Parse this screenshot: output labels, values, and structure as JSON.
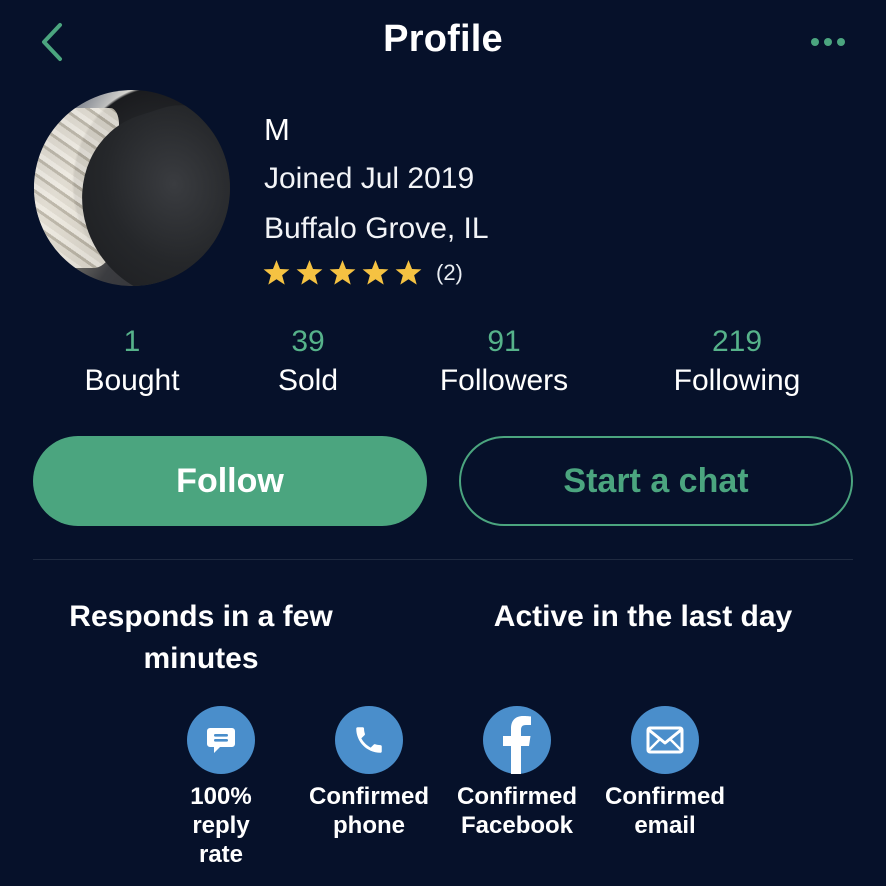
{
  "header": {
    "title": "Profile",
    "back_icon": "chevron-left-icon",
    "more_icon": "more-horizontal-icon"
  },
  "profile": {
    "name": "M",
    "joined": "Joined Jul 2019",
    "location": "Buffalo Grove, IL",
    "rating": 5,
    "rating_max": 5,
    "rating_count": "(2)"
  },
  "stats": [
    {
      "value": "1",
      "label": "Bought"
    },
    {
      "value": "39",
      "label": "Sold"
    },
    {
      "value": "91",
      "label": "Followers"
    },
    {
      "value": "219",
      "label": "Following"
    }
  ],
  "actions": {
    "follow_label": "Follow",
    "chat_label": "Start a chat"
  },
  "status": {
    "responds": "Responds in a few minutes",
    "active": "Active in the last day"
  },
  "badges": [
    {
      "icon": "chat-bubble-icon",
      "label": "100% reply rate"
    },
    {
      "icon": "phone-icon",
      "label": "Confirmed phone"
    },
    {
      "icon": "facebook-icon",
      "label": "Confirmed Facebook"
    },
    {
      "icon": "email-icon",
      "label": "Confirmed email"
    }
  ],
  "colors": {
    "background": "#06112a",
    "accent": "#4ba57f",
    "badge": "#4a8ecb",
    "star": "#f5c242"
  }
}
